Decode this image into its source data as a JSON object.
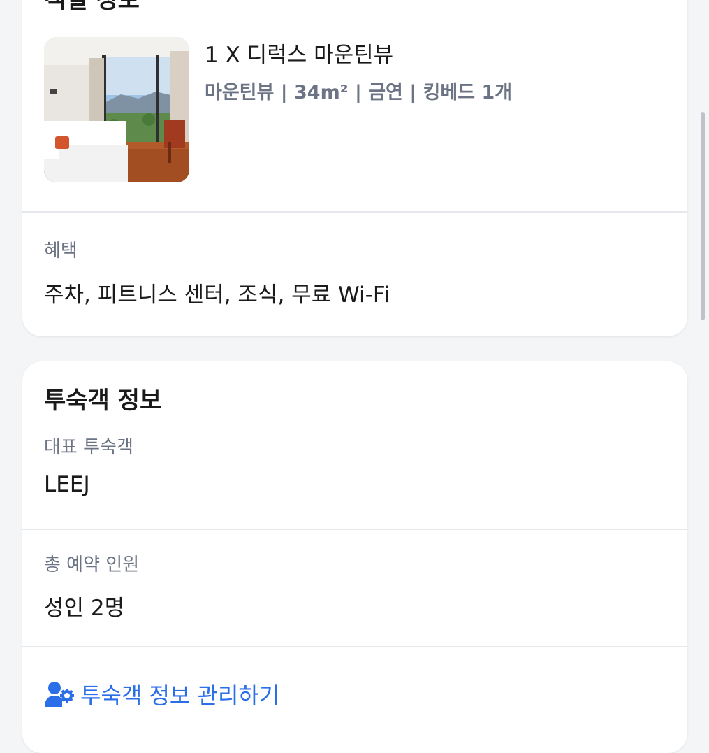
{
  "room_card": {
    "title": "객실 정보",
    "room_name": "1 X 디럭스 마운틴뷰",
    "room_meta": "마운틴뷰 | 34m² | 금연 | 킹베드 1개",
    "benefits_label": "혜택",
    "benefits_value": "주차, 피트니스 센터, 조식, 무료 Wi-Fi"
  },
  "guest_card": {
    "title": "투숙객 정보",
    "main_guest_label": "대표 투숙객",
    "main_guest_value": "LEEJ",
    "total_guests_label": "총 예약 인원",
    "total_guests_value": "성인 2명",
    "manage_link": "투숙객 정보 관리하기",
    "manage_icon": "user-gear-icon"
  },
  "colors": {
    "accent": "#2a6ee8",
    "muted_text": "#6b7384",
    "background": "#f4f5f7"
  }
}
